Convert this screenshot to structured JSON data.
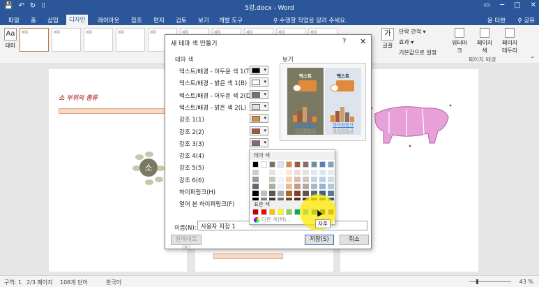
{
  "window": {
    "title": "5강.docx - Word",
    "quick_access": [
      "💾",
      "↶",
      "↻",
      "⌷"
    ]
  },
  "tabs": [
    "파일",
    "홈",
    "삽입",
    "디자인",
    "레이아웃",
    "참조",
    "편지",
    "검토",
    "보기",
    "개발 도구"
  ],
  "active_tab": "디자인",
  "tell_me": "♀ 수행할 작업을 알려 주세요.",
  "user": "윤 터한",
  "share": "♀ 공유",
  "ribbon": {
    "theme_label": "테마",
    "theme_icon": "가",
    "gallery_caption": "제목",
    "fonts_label": "글꼴",
    "paragraph_spacing": "단락 간격 ▾",
    "effects": "효과 ▾",
    "set_default": "기본값으로 설정",
    "watermark": "워터마크",
    "page_color": "페이지 색",
    "page_borders": "페이지 테두리",
    "page_background_group": "페이지 배경"
  },
  "document": {
    "page1_title": "소 부위의 종류",
    "mind_center": "소"
  },
  "status": {
    "section": "구역: 1",
    "pages": "2/3 페이지",
    "words": "108개 단어",
    "lang": "한국어",
    "zoom": "43 %"
  },
  "dialog": {
    "title": "새 테마 색 만들기",
    "help": "?",
    "close": "✕",
    "section_theme_colors": "테마 색",
    "section_preview": "보기",
    "rows": [
      {
        "label": "텍스트/배경 - 어두운 색 1(T)",
        "color": "#000000"
      },
      {
        "label": "텍스트/배경 - 밝은 색 1(B)",
        "color": "#ffffff"
      },
      {
        "label": "텍스트/배경 - 어두운 색 2(D)",
        "color": "#6d7a5d"
      },
      {
        "label": "텍스트/배경 - 밝은 색 2(L)",
        "color": "#dde4ee"
      },
      {
        "label": "강조 1(1)",
        "color": "#e08a3c"
      },
      {
        "label": "강조 2(2)",
        "color": "#a5553a"
      },
      {
        "label": "강조 3(3)",
        "color": "#8a6b6b"
      },
      {
        "label": "강조 4(4)",
        "color": ""
      },
      {
        "label": "강조 5(5)",
        "color": ""
      },
      {
        "label": "강조 6(6)",
        "color": ""
      },
      {
        "label": "하이퍼링크(H)",
        "color": ""
      },
      {
        "label": "열어 본 하이퍼링크(F)",
        "color": ""
      }
    ],
    "preview_title": "텍스트",
    "preview_link": "하이퍼링크",
    "preview_visited": "하이퍼링크",
    "name_label": "이름(N):",
    "name_value": "사용자 지정 1",
    "reset_button": "원래대로(R)",
    "save_button": "저장(S)",
    "cancel_button": "취소"
  },
  "picker": {
    "theme_colors_header": "테마 색",
    "standard_colors_header": "표준 색",
    "more_colors": "다른 색(M)...",
    "tooltip": "자주",
    "theme_top": [
      "#000000",
      "#ffffff",
      "#6d7a5d",
      "#dde4ee",
      "#e08a3c",
      "#a5553a",
      "#8a6b6b",
      "#6b8fa5",
      "#5a7fb5",
      "#7fa5c5"
    ],
    "standard": [
      "#c00000",
      "#ff0000",
      "#ffc000",
      "#ffff00",
      "#92d050",
      "#00b050",
      "#00b0f0",
      "#0070c0",
      "#002060",
      "#7030a0"
    ]
  },
  "icons": {
    "save": "save-icon",
    "undo": "undo-icon",
    "redo": "redo-icon"
  }
}
